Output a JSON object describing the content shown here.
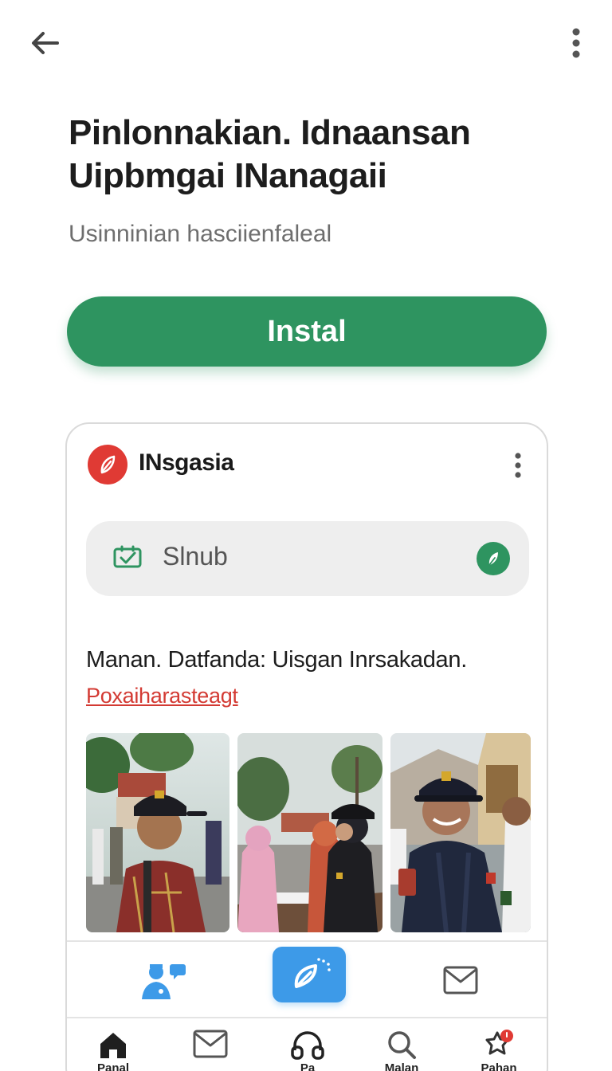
{
  "top_bar": {
    "back_icon": "arrow-left-icon",
    "menu_icon": "more-vertical-icon"
  },
  "title": "Pinlonnakian. Idnaansan\nUipbmgai INanagaii",
  "subtitle": "Usinninian hasciienfaleal",
  "install_label": "Instal",
  "colors": {
    "primary": "#2e9460",
    "accent_red": "#e03a34",
    "link_red": "#d33a33",
    "blue": "#3d9ae8"
  },
  "card": {
    "app_name": "INsgasia",
    "search": {
      "value": "Slnub"
    },
    "message": "Manan. Datfanda: Uisgan Inrsakadan.",
    "link": "Poxaiharasteagt",
    "actions": [
      "person-speech-icon",
      "leaf-compose-icon",
      "mail-icon"
    ]
  },
  "bottom_nav": [
    {
      "icon": "home-icon",
      "label": "Panal"
    },
    {
      "icon": "mail-icon",
      "label": ""
    },
    {
      "icon": "headphones-icon",
      "label": "Pa"
    },
    {
      "icon": "search-icon",
      "label": "Malan"
    },
    {
      "icon": "notification-icon",
      "label": "Pahan"
    }
  ]
}
